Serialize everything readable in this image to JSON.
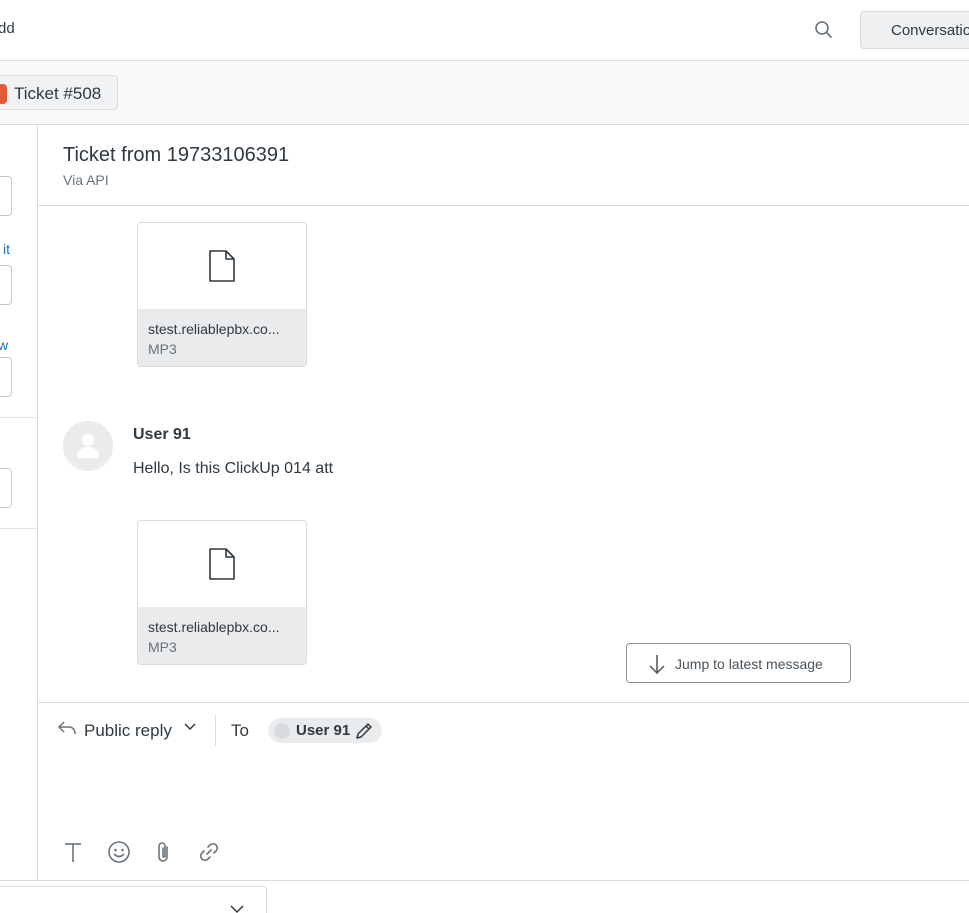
{
  "header": {
    "left_text": "dd",
    "conversations_label": "Conversations"
  },
  "tabs": [
    {
      "label": "Ticket #508",
      "badge_color": "#e35b36"
    }
  ],
  "sidebar": {
    "link_1": "it",
    "link_2": "w"
  },
  "ticket": {
    "title": "Ticket from 19733106391",
    "via": "Via API"
  },
  "conversation": {
    "attachments": [
      {
        "filename": "stest.reliablepbx.co...",
        "type": "MP3"
      },
      {
        "filename": "stest.reliablepbx.co...",
        "type": "MP3"
      }
    ],
    "message": {
      "author": "User 91",
      "text": "Hello, Is this ClickUp 014 att"
    },
    "jump_label": "Jump to latest message"
  },
  "composer": {
    "reply_type": "Public reply",
    "to_label": "To",
    "recipient": "User 91"
  },
  "colors": {
    "accent": "#1f73b7",
    "badge": "#e35b36",
    "border": "#d8dcde"
  }
}
